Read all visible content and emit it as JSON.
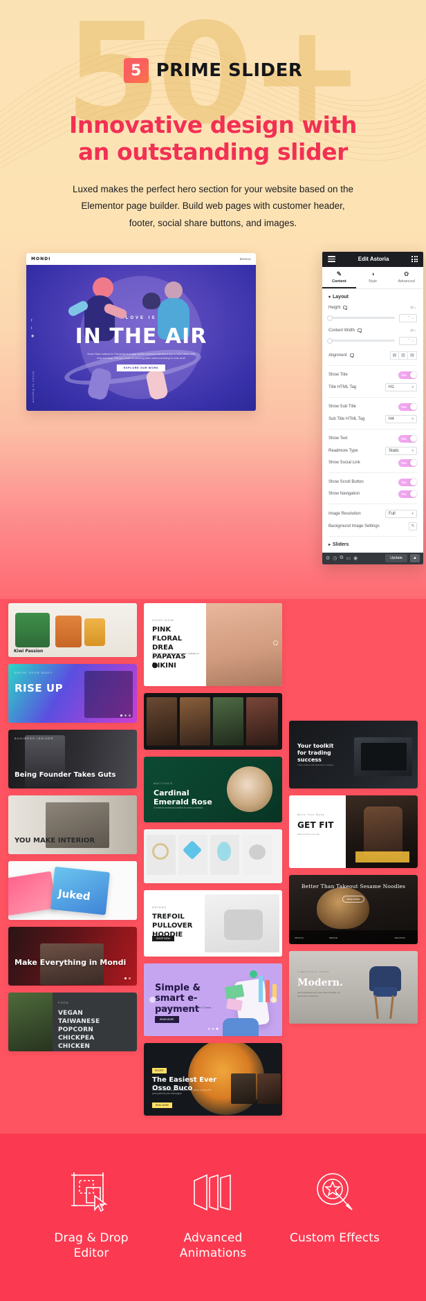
{
  "hero": {
    "watermark": "50+",
    "brand_logo_glyph": "5",
    "brand_name": "PRIME SLIDER",
    "title": "Innovative design with an outstanding slider",
    "subtitle": "Luxed makes the perfect hero section for your website based on the Elementor page builder. Build web pages with customer header, footer, social share buttons, and images.",
    "accent_color": "#f23054",
    "bg_color": "#fde4b5"
  },
  "slider_preview": {
    "logo": "MONDI",
    "nav": "Demos",
    "love_label": "LOVE IS",
    "headline": "IN THE AIR",
    "description": "Mondi Slider Addons for Elementor is a page builder extension that allows you to build sliders with drag and drop. It let you create an amazing slider without touching no code at all",
    "button": "EXPLORE OUR WORK",
    "scroll_label": "Scroll to Explore"
  },
  "editor": {
    "title": "Edit Astoria",
    "menu_icon": "hamburger-icon",
    "apps_icon": "grid-apps-icon",
    "tabs": [
      {
        "label": "Content",
        "icon": "pencil-icon",
        "glyph": "✎",
        "active": true
      },
      {
        "label": "Style",
        "icon": "contrast-icon",
        "glyph": "◑",
        "active": false
      },
      {
        "label": "Advanced",
        "icon": "gear-icon",
        "glyph": "✿",
        "active": false
      }
    ],
    "section_layout": "Layout",
    "section_sliders": "Sliders",
    "controls": [
      {
        "type": "slider",
        "label": "Height",
        "unit": "px",
        "device": "desktop-icon",
        "value": ""
      },
      {
        "type": "slider",
        "label": "Content Width",
        "unit": "px",
        "device": "desktop-icon",
        "value": ""
      },
      {
        "type": "align",
        "label": "Alignment",
        "device": "desktop-icon",
        "options": [
          "align-left",
          "align-center",
          "align-right"
        ]
      },
      {
        "type": "toggle",
        "label": "Show Title",
        "value": "Yes"
      },
      {
        "type": "select",
        "label": "Title HTML Tag",
        "value": "H1"
      },
      {
        "type": "toggle",
        "label": "Show Sub Title",
        "value": "Yes"
      },
      {
        "type": "select",
        "label": "Sub Title HTML Tag",
        "value": "H4"
      },
      {
        "type": "toggle",
        "label": "Show Text",
        "value": "Yes"
      },
      {
        "type": "select",
        "label": "Readmore Type",
        "value": "Static"
      },
      {
        "type": "toggle",
        "label": "Show Social Link",
        "value": "Yes"
      },
      {
        "type": "toggle",
        "label": "Show Scroll Button",
        "value": "Yes"
      },
      {
        "type": "toggle",
        "label": "Show Navigation",
        "value": "Yes"
      },
      {
        "type": "select",
        "label": "Image Resolution",
        "value": "Full"
      },
      {
        "type": "edit",
        "label": "Background Image Settings",
        "icon": "pencil-icon"
      }
    ],
    "footer": {
      "settings_icon": "gear-icon",
      "history_icon": "history-icon",
      "navigator_icon": "navigator-icon",
      "responsive_icon": "responsive-icon",
      "preview_icon": "eye-icon",
      "update_label": "Update",
      "caret": "▲"
    },
    "toggle_on_color": "#ee9ced"
  },
  "gallery": {
    "bg_color": "#fe5361",
    "left_column": [
      {
        "name": "kiwi-passion",
        "label": "Kiwi Passion",
        "kicker": "",
        "style": "product-light"
      },
      {
        "name": "rise-up",
        "label": "RISE UP",
        "kicker": "DRIVE YOUR BODY",
        "style": "gradient-pink"
      },
      {
        "name": "founder-takes-guts",
        "label": "Being Founder Takes Guts",
        "kicker": "BUSINESS INSIDER",
        "style": "dark-portrait"
      },
      {
        "name": "you-make-interior",
        "label": "YOU MAKE INTERIOR",
        "kicker": "",
        "style": "interior-grey"
      },
      {
        "name": "juked-anzu",
        "label": "Juked",
        "kicker": "",
        "style": "cards-light"
      },
      {
        "name": "make-everything-mondi",
        "label": "Make Everything in Mondi",
        "kicker": "",
        "style": "red-laptop"
      },
      {
        "name": "vegan-taiwanese",
        "label": "VEGAN TAIWANESE POPCORN CHICKPEA CHICKEN RECIPE",
        "kicker": "FOOD",
        "style": "food-dark"
      }
    ],
    "center_column": [
      {
        "name": "pink-floral-bikini",
        "label": "PINK FLORAL DREA PAPAYAS BIKINI",
        "kicker": "SHOP NOW",
        "style": "white-fashion"
      },
      {
        "name": "food-grid",
        "label": "",
        "kicker": "",
        "style": "food-grid-dark"
      },
      {
        "name": "cardinal-emerald-rose",
        "label": "Cardinal Emerald Rose",
        "kicker": "WATCHES",
        "style": "green-watch"
      },
      {
        "name": "jewellery-row",
        "label": "",
        "kicker": "",
        "style": "jewellery-light"
      },
      {
        "name": "trefoil-pullover-hoodie",
        "label": "TREFOIL PULLOVER HOODIE",
        "kicker": "ADIDAS",
        "style": "white-hoodie"
      },
      {
        "name": "simple-smart-epayment",
        "label": "Simple & smart e-payment",
        "kicker": "",
        "style": "purple-payment"
      },
      {
        "name": "easiest-ever-osso-buco",
        "label": "The Easiest Ever Osso Buco",
        "kicker": "RECIPE",
        "style": "dark-osso"
      }
    ],
    "right_column": [
      {
        "name": "trading-toolkit",
        "label": "Your toolkit for trading success",
        "kicker": "",
        "style": "dark-trading"
      },
      {
        "name": "get-fit",
        "label": "GET FIT",
        "kicker": "Work Your Body",
        "style": "dark-fitness"
      },
      {
        "name": "sesame-noodles",
        "label": "Better Than Takeout Sesame Noodles",
        "kicker": "",
        "style": "dark-noodles"
      },
      {
        "name": "modern-chair",
        "label": "Modern.",
        "kicker": "A BEAUTIFUL CHAIR",
        "style": "grey-chair"
      }
    ]
  },
  "features": {
    "bg_color": "#fb3a51",
    "items": [
      {
        "icon": "drag-drop-cursor-icon",
        "label": "Drag & Drop Editor"
      },
      {
        "icon": "layers-animation-icon",
        "label": "Advanced Animations"
      },
      {
        "icon": "magic-wand-target-icon",
        "label": "Custom Effects"
      }
    ]
  }
}
